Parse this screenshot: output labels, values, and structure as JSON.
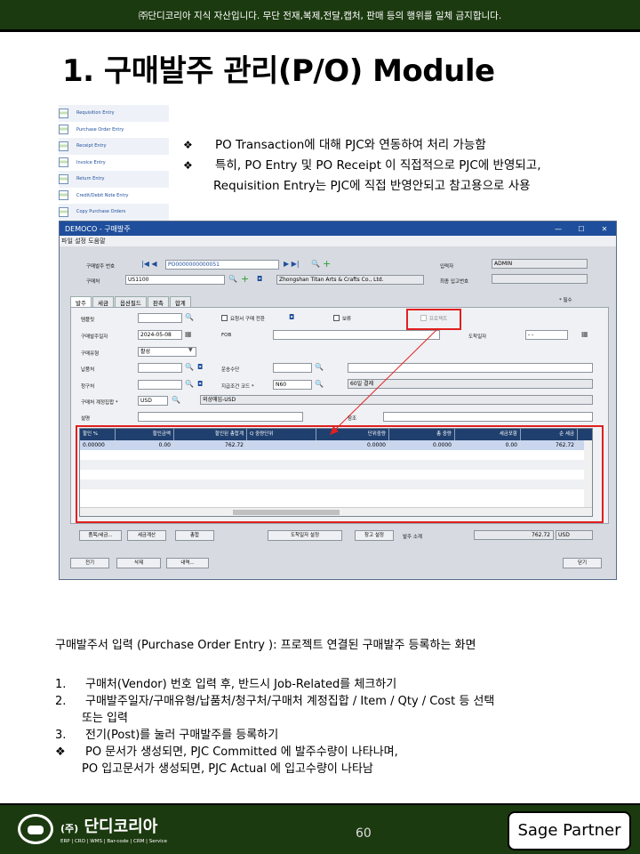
{
  "top_notice": "㈜단디코리아 지식 자산입니다. 무단 전재,복제,전달,캡처, 판매 등의 행위를 일체 금지합니다.",
  "title": "1. 구매발주 관리(P/O) Module",
  "menu": [
    "Requisition Entry",
    "Purchase Order Entry",
    "Receipt Entry",
    "Invoice Entry",
    "Return Entry",
    "Credit/Debit Note Entry",
    "Copy Purchase Orders"
  ],
  "bullets": {
    "b1": "PO Transaction에 대해 PJC와 연동하여 처리 가능함",
    "b2": "특히, PO Entry 및 PO Receipt 이 직접적으로 PJC에 반영되고,",
    "b2c": "Requisition Entry는 PJC에 직접 반영안되고 참고용으로 사용",
    "marker": "❖"
  },
  "window": {
    "title": "DEMOCO - 구매발주",
    "controls": [
      "—",
      "☐",
      "✕"
    ],
    "menubar": "파일  설정  도움말",
    "po_label": "구매발주 번호",
    "po_value": "PO0000000000051",
    "vendor_label": "구매처",
    "vendor_code": "US1100",
    "vendor_name": "Zhongshan Titan Arts & Crafts Co., Ltd.",
    "entered_by_label": "입력자",
    "entered_by": "ADMIN",
    "last_receipt_label": "최종 입고번호",
    "tabs": [
      "발주",
      "세금",
      "옵션필드",
      "판촉",
      "합계"
    ],
    "required_note": "* 필수",
    "template_label": "템플릿",
    "req_convert_label": "요청서 구매 전환",
    "hold_label": "보류",
    "project_label": "프로젝트",
    "po_date_label": "구매발주일자",
    "po_date": "2024-05-08",
    "fob_label": "FOB",
    "arrival_label": "도착일자",
    "arrival_value": "-  -",
    "type_label": "구매유형",
    "type_value": "활성",
    "ship_to_label": "납품처",
    "ship_via_label": "운송수단",
    "bill_to_label": "청구처",
    "terms_label": "지급조건 코드 *",
    "terms_code": "N60",
    "terms_desc": "60일 결제",
    "rate_label": "구매처 계정집합 *",
    "rate_code": "USD",
    "rate_desc": "외상매입-USD",
    "desc_label": "설명",
    "ref_label": "참조",
    "grid_headers": [
      "할인 %",
      "할인금액",
      "할인된 총합계",
      "Q 중량단위",
      "단위중량",
      "총 중량",
      "세금포함",
      "순 세금"
    ],
    "grid_row": [
      "0.00000",
      "0.00",
      "762.72",
      "",
      "0.0000",
      "0.0000",
      "0.00",
      "762.72"
    ],
    "btn_items": "품목/세금...",
    "btn_tax": "세금계산",
    "btn_total": "총합",
    "btn_arrival": "도착일자 설정",
    "btn_warehouse": "창고 설정",
    "po_total_label": "발주 소계",
    "po_total": "762.72",
    "po_currency": "USD",
    "btn_post": "전기",
    "btn_delete": "삭제",
    "btn_history": "내역...",
    "btn_close": "닫기"
  },
  "description": "구매발주서 입력 (Purchase Order Entry ): 프로젝트 연결된 구매발주 등록하는 화면",
  "steps": [
    {
      "n": "1.",
      "t": "구매처(Vendor) 번호 입력 후, 반드시 Job-Related를 체크하기"
    },
    {
      "n": "2.",
      "t": "구매발주일자/구매유형/납품처/청구처/구매처 계정집합  / Item / Qty / Cost  등 선택",
      "c": "또는 입력"
    },
    {
      "n": "3.",
      "t": "전기(Post)를 눌러 구매발주를 등록하기"
    }
  ],
  "note": {
    "marker": "❖",
    "t": "PO 문서가 생성되면, PJC Committed 에 발주수량이 나타나며,",
    "c": "PO 입고문서가 생성되면, PJC Actual 에 입고수량이 나타남"
  },
  "footer": {
    "company": "단디코리아",
    "company_prefix": "(주)",
    "tagline": "ERP | CRO | WMS | Bar-code | CRM | Service",
    "page": "60",
    "partner": "Sage Partner"
  }
}
